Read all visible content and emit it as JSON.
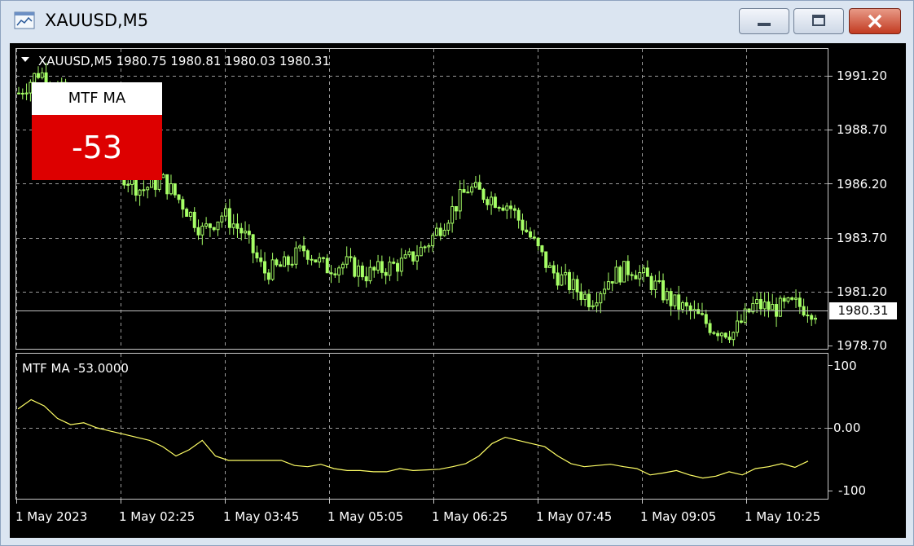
{
  "window": {
    "title": "XAUUSD,M5",
    "buttons": {
      "minimize": "minimize",
      "maximize": "maximize",
      "close": "close"
    }
  },
  "main_chart": {
    "header": "XAUUSD,M5  1980.75 1980.81 1980.03 1980.31",
    "price_labels": [
      "1991.20",
      "1988.70",
      "1986.20",
      "1983.70",
      "1981.20",
      "1978.70"
    ],
    "current_price": "1980.31",
    "candle_color": "#a6ff66",
    "background": "#000000"
  },
  "mtf_panel": {
    "title": "MTF MA",
    "value": "-53",
    "value_bg": "#dd0000"
  },
  "indicator": {
    "header": "MTF MA -53.0000",
    "levels": [
      "100",
      "0.00",
      "-100"
    ],
    "line_color": "#ffff66"
  },
  "time_axis": [
    "1 May 2023",
    "1 May 02:25",
    "1 May 03:45",
    "1 May 05:05",
    "1 May 06:25",
    "1 May 07:45",
    "1 May 09:05",
    "1 May 10:25"
  ],
  "chart_data": [
    {
      "type": "candlestick",
      "title": "XAUUSD,M5",
      "ylim": [
        1978.2,
        1992.3
      ],
      "x": [
        "1 May 2023",
        "1 May 02:25",
        "1 May 03:45",
        "1 May 05:05",
        "1 May 06:25",
        "1 May 07:45",
        "1 May 09:05",
        "1 May 10:25"
      ],
      "close_path": [
        1990.4,
        1991.4,
        1990.6,
        1989.2,
        1987.5,
        1986.7,
        1985.9,
        1986.4,
        1985.3,
        1984.0,
        1984.8,
        1983.9,
        1982.1,
        1982.4,
        1983.2,
        1982.3,
        1982.5,
        1982.0,
        1982.3,
        1982.6,
        1983.4,
        1984.7,
        1986.0,
        1985.6,
        1985.2,
        1983.8,
        1982.2,
        1981.5,
        1980.8,
        1981.9,
        1982.3,
        1981.6,
        1980.7,
        1980.2,
        1979.5,
        1979.3,
        1980.6,
        1980.4,
        1980.6,
        1980.31
      ],
      "last": {
        "open": 1980.75,
        "high": 1980.81,
        "low": 1980.03,
        "close": 1980.31
      }
    },
    {
      "type": "line",
      "title": "MTF MA -53.0000",
      "ylim": [
        -100,
        100
      ],
      "values": [
        30,
        45,
        35,
        15,
        5,
        8,
        0,
        -5,
        -10,
        -15,
        -20,
        -30,
        -45,
        -35,
        -20,
        -45,
        -52,
        -52,
        -52,
        -52,
        -52,
        -60,
        -62,
        -58,
        -65,
        -68,
        -68,
        -70,
        -70,
        -65,
        -68,
        -67,
        -66,
        -62,
        -57,
        -45,
        -25,
        -15,
        -20,
        -25,
        -30,
        -45,
        -57,
        -62,
        -60,
        -58,
        -62,
        -65,
        -75,
        -72,
        -68,
        -75,
        -80,
        -77,
        -70,
        -75,
        -65,
        -62,
        -57,
        -63,
        -53
      ],
      "levels": [
        100,
        0,
        -100
      ]
    }
  ]
}
